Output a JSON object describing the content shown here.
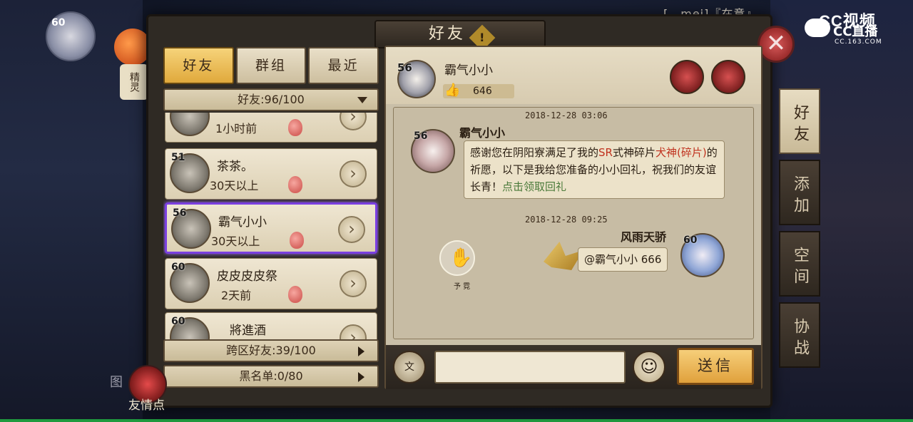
{
  "overlay": {
    "top_user": "[、mei]『在意』",
    "cc_logo": {
      "line1": "CC视频",
      "line2": "CC直播",
      "line3": "CC.163.COM"
    }
  },
  "hud": {
    "player_level": "60",
    "spirit_tag": "精灵",
    "tujian": "图",
    "friendship_points_label": "友情点"
  },
  "panel": {
    "title": "好友",
    "info_icon": "!",
    "close_icon": "✕"
  },
  "tabs": [
    {
      "label": "好友",
      "active": true
    },
    {
      "label": "群组",
      "active": false
    },
    {
      "label": "最近",
      "active": false
    }
  ],
  "friend_count": "好友:96/100",
  "friends": [
    {
      "level": "",
      "name": "",
      "time": "1小时前"
    },
    {
      "level": "51",
      "name": "茶茶。",
      "time": "30天以上"
    },
    {
      "level": "56",
      "name": "霸气小小",
      "time": "30天以上",
      "selected": true
    },
    {
      "level": "60",
      "name": "皮皮皮皮祭",
      "time": "2天前"
    },
    {
      "level": "60",
      "name": "將進酒",
      "time": ""
    }
  ],
  "cross_server": "跨区好友:39/100",
  "blacklist": "黑名单:0/80",
  "chat": {
    "header": {
      "level": "56",
      "name": "霸气小小",
      "likes": "646"
    },
    "messages": [
      {
        "timestamp": "2018-12-28 03:06",
        "sender": "霸气小小",
        "level": "56",
        "text_1": "感谢您在阴阳寮满足了我的",
        "text_red_1": "SR",
        "text_2": "式神碎片",
        "text_red_2": "犬神(碎片)",
        "text_3": "的祈愿，以下是我给您准备的小小回礼，祝我们的友谊长青！",
        "link": "点击领取回礼"
      },
      {
        "timestamp": "2018-12-28 09:25",
        "sender": "风雨天骄",
        "level": "60",
        "text": "@霸气小小 666"
      }
    ],
    "touch_label": "予 霓",
    "input_placeholder": "",
    "voice_label": "文",
    "emoji": "☺",
    "send_label": "送信"
  },
  "side_tabs": [
    {
      "label": "好友",
      "active": true
    },
    {
      "label": "添加",
      "active": false
    },
    {
      "label": "空间",
      "active": false
    },
    {
      "label": "协战",
      "active": false
    }
  ],
  "colors": {
    "tab_active": "#e0a93c",
    "selected_border": "#7a3fe0",
    "accent_red": "#c0321e",
    "link_green": "#4a7a3a"
  }
}
